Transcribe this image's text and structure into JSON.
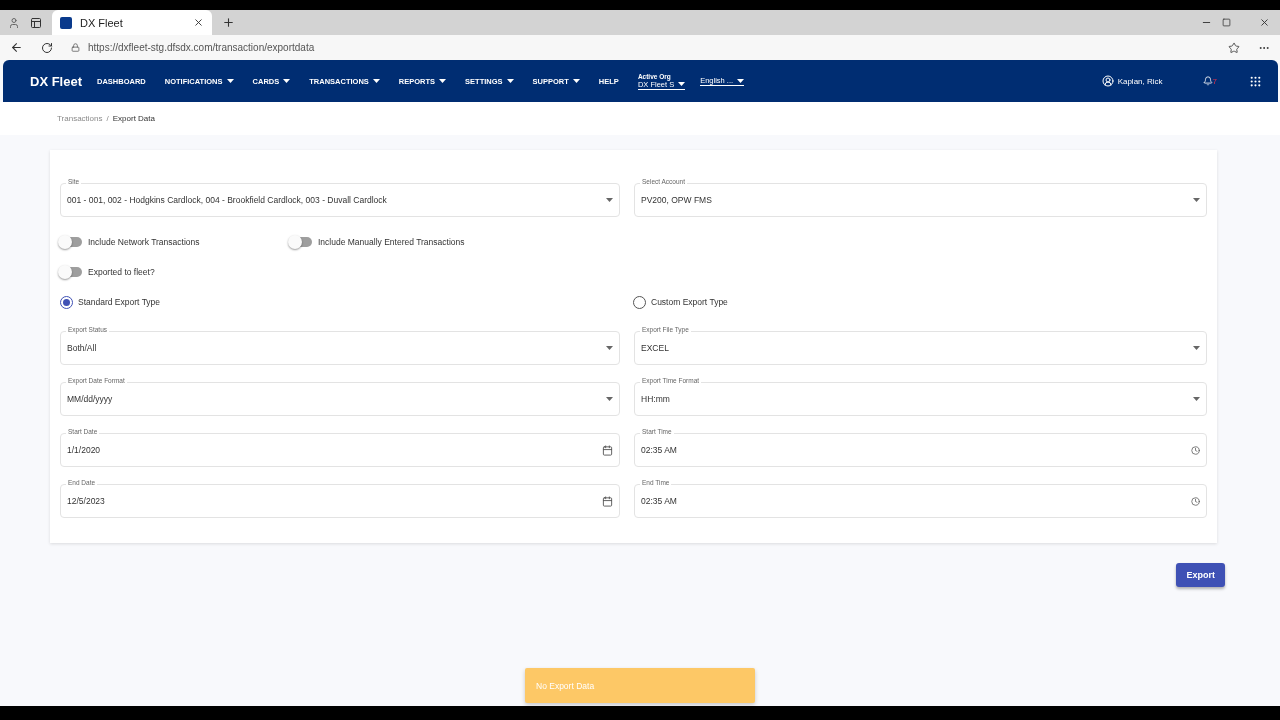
{
  "browser": {
    "tab_title": "DX Fleet",
    "url": "https://dxfleet-stg.dfsdx.com/transaction/exportdata"
  },
  "nav": {
    "brand": "DX Fleet",
    "items": [
      {
        "label": "DASHBOARD",
        "dropdown": false
      },
      {
        "label": "NOTIFICATIONS",
        "dropdown": true
      },
      {
        "label": "CARDS",
        "dropdown": true
      },
      {
        "label": "TRANSACTIONS",
        "dropdown": true
      },
      {
        "label": "REPORTS",
        "dropdown": true
      },
      {
        "label": "SETTINGS",
        "dropdown": true
      },
      {
        "label": "SUPPORT",
        "dropdown": true
      },
      {
        "label": "HELP",
        "dropdown": false
      }
    ],
    "active_org": {
      "caption": "Active Org",
      "value": "DX Fleet S"
    },
    "language": "English ...",
    "user": "Kaplan, Rick",
    "notification_count": "7"
  },
  "breadcrumb": {
    "items": [
      "Transactions",
      "Export Data"
    ],
    "separator": "/"
  },
  "top_fields": [
    {
      "kind": "select",
      "label": "Site",
      "value": "001 - 001, 002 - Hodgkins Cardlock, 004 - Brookfield Cardlock, 003 - Duvall Cardlock"
    },
    {
      "kind": "select",
      "label": "Select Account",
      "value": "PV200, OPW FMS"
    }
  ],
  "toggles": [
    {
      "label": "Include Network Transactions",
      "on": false
    },
    {
      "label": "Include Manually Entered Transactions",
      "on": false
    },
    {
      "label": "Exported to fleet?",
      "on": false
    }
  ],
  "export_types": [
    {
      "label": "Standard Export Type",
      "selected": true
    },
    {
      "label": "Custom Export Type",
      "selected": false
    }
  ],
  "fields": [
    {
      "kind": "select",
      "label": "Export Status",
      "value": "Both/All"
    },
    {
      "kind": "select",
      "label": "Export File Type",
      "value": "EXCEL"
    },
    {
      "kind": "select",
      "label": "Export Date Format",
      "value": "MM/dd/yyyy"
    },
    {
      "kind": "select",
      "label": "Export Time Format",
      "value": "HH:mm"
    },
    {
      "kind": "date",
      "label": "Start Date",
      "value": "1/1/2020"
    },
    {
      "kind": "time",
      "label": "Start Time",
      "value": "02:35 AM"
    },
    {
      "kind": "date",
      "label": "End Date",
      "value": "12/5/2023"
    },
    {
      "kind": "time",
      "label": "End Time",
      "value": "02:35 AM"
    }
  ],
  "export_button": "Export",
  "toast": "No Export Data"
}
